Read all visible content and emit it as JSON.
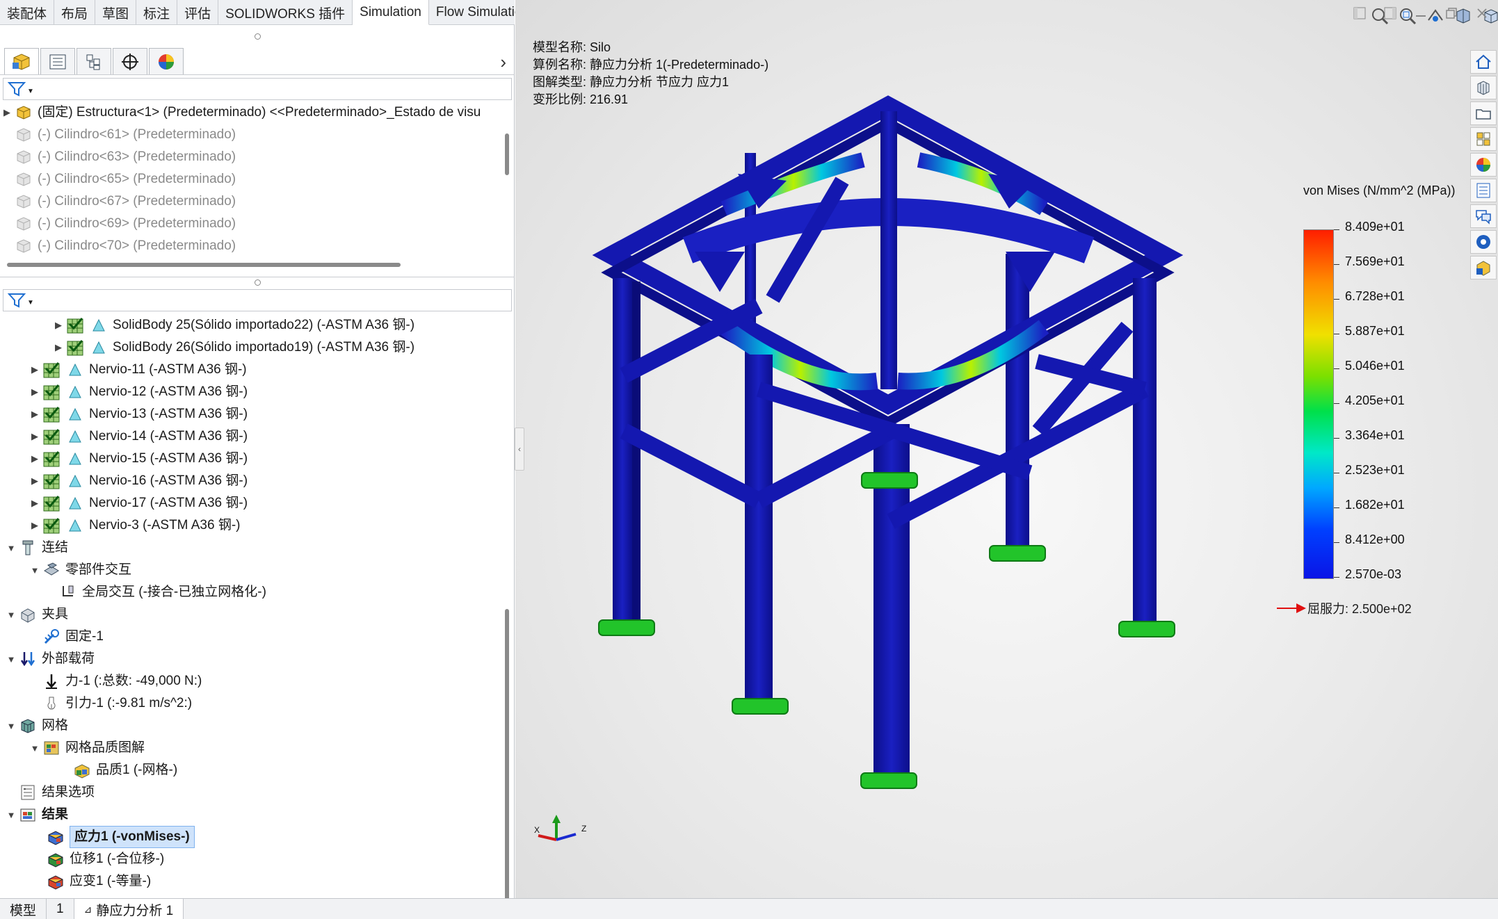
{
  "command_tabs": [
    "装配体",
    "布局",
    "草图",
    "标注",
    "评估",
    "SOLIDWORKS 插件",
    "Simulation",
    "Flow Simulation"
  ],
  "active_command_tab": "Simulation",
  "top_tree": [
    {
      "label": "(固定) Estructura<1> (Predeterminado) <<Predeterminado>_Estado de visu",
      "state": "normal"
    },
    {
      "label": "(-) Cilindro<61> (Predeterminado)",
      "state": "suppressed"
    },
    {
      "label": "(-) Cilindro<63> (Predeterminado)",
      "state": "suppressed"
    },
    {
      "label": "(-) Cilindro<65> (Predeterminado)",
      "state": "suppressed"
    },
    {
      "label": "(-) Cilindro<67> (Predeterminado)",
      "state": "suppressed"
    },
    {
      "label": "(-) Cilindro<69> (Predeterminado)",
      "state": "suppressed"
    },
    {
      "label": "(-) Cilindro<70> (Predeterminado)",
      "state": "suppressed"
    }
  ],
  "sim_tree": {
    "bodies": [
      "SolidBody 25(Sólido importado22) (-ASTM A36 钢-)",
      "SolidBody 26(Sólido importado19) (-ASTM A36 钢-)",
      "Nervio-11 (-ASTM A36 钢-)",
      "Nervio-12 (-ASTM A36 钢-)",
      "Nervio-13 (-ASTM A36 钢-)",
      "Nervio-14 (-ASTM A36 钢-)",
      "Nervio-15 (-ASTM A36 钢-)",
      "Nervio-16 (-ASTM A36 钢-)",
      "Nervio-17 (-ASTM A36 钢-)",
      "Nervio-3 (-ASTM A36 钢-)"
    ],
    "connections": "连结",
    "component_interactions": "零部件交互",
    "global_interaction": "全局交互 (-接合-已独立网格化-)",
    "fixtures": "夹具",
    "fixed": "固定-1",
    "external_loads": "外部载荷",
    "force": "力-1 (:总数: -49,000 N:)",
    "gravity": "引力-1 (:-9.81 m/s^2:)",
    "mesh": "网格",
    "mesh_quality_plot": "网格品质图解",
    "quality": "品质1 (-网格-)",
    "result_options": "结果选项",
    "results": "结果",
    "stress": "应力1 (-vonMises-)",
    "displacement": "位移1 (-合位移-)",
    "strain": "应变1 (-等量-)"
  },
  "bottom_tabs": [
    "模型",
    "1",
    "静应力分析 1"
  ],
  "info": {
    "model_name": "模型名称: Silo",
    "study_name": "算例名称: 静应力分析 1(-Predeterminado-)",
    "plot_type": "图解类型: 静应力分析 节应力 应力1",
    "deform_scale": "变形比例: 216.91"
  },
  "legend": {
    "title": "von Mises (N/mm^2 (MPa))",
    "values": [
      "8.409e+01",
      "7.569e+01",
      "6.728e+01",
      "5.887e+01",
      "5.046e+01",
      "4.205e+01",
      "3.364e+01",
      "2.523e+01",
      "1.682e+01",
      "8.412e+00",
      "2.570e-03"
    ],
    "yield": "屈服力: 2.500e+02"
  },
  "triad": {
    "x": "X",
    "y": "Y",
    "z": "Z"
  },
  "colors": {
    "structure": "#1418b0",
    "fixture": "#22c42a",
    "accent": "#1f6fd1"
  }
}
